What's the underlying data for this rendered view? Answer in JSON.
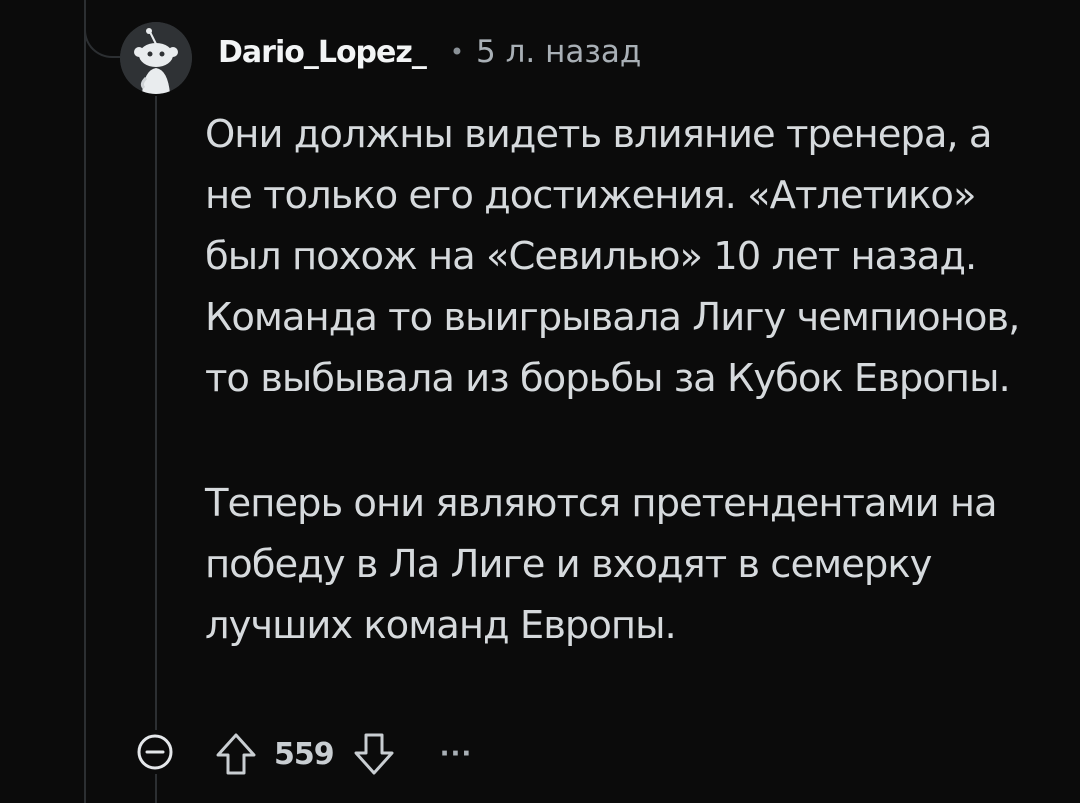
{
  "comment": {
    "username": "Dario_Lopez_",
    "separator": "•",
    "timestamp": "5 л. назад",
    "paragraphs": [
      "Они должны видеть влияние тренера, а не только его достижения. «Атлетико» был похож на «Севилью» 10 лет назад. Команда то выигрывала Лигу чемпионов, то выбывала из борьбы за Кубок Европы.",
      "Теперь они являются претендентами на победу в Ла Лиге и входят в семерку лучших команд Европы."
    ],
    "score": "559",
    "more_label": "···"
  },
  "icons": {
    "avatar": "snoo-avatar-icon",
    "collapse": "collapse-minus-icon",
    "upvote": "upvote-arrow-icon",
    "downvote": "downvote-arrow-icon",
    "more": "more-options-icon"
  },
  "colors": {
    "background": "#0b0b0b",
    "thread_line": "#2c2f32",
    "text": "#d6dadd",
    "muted": "#a9b0b6"
  }
}
